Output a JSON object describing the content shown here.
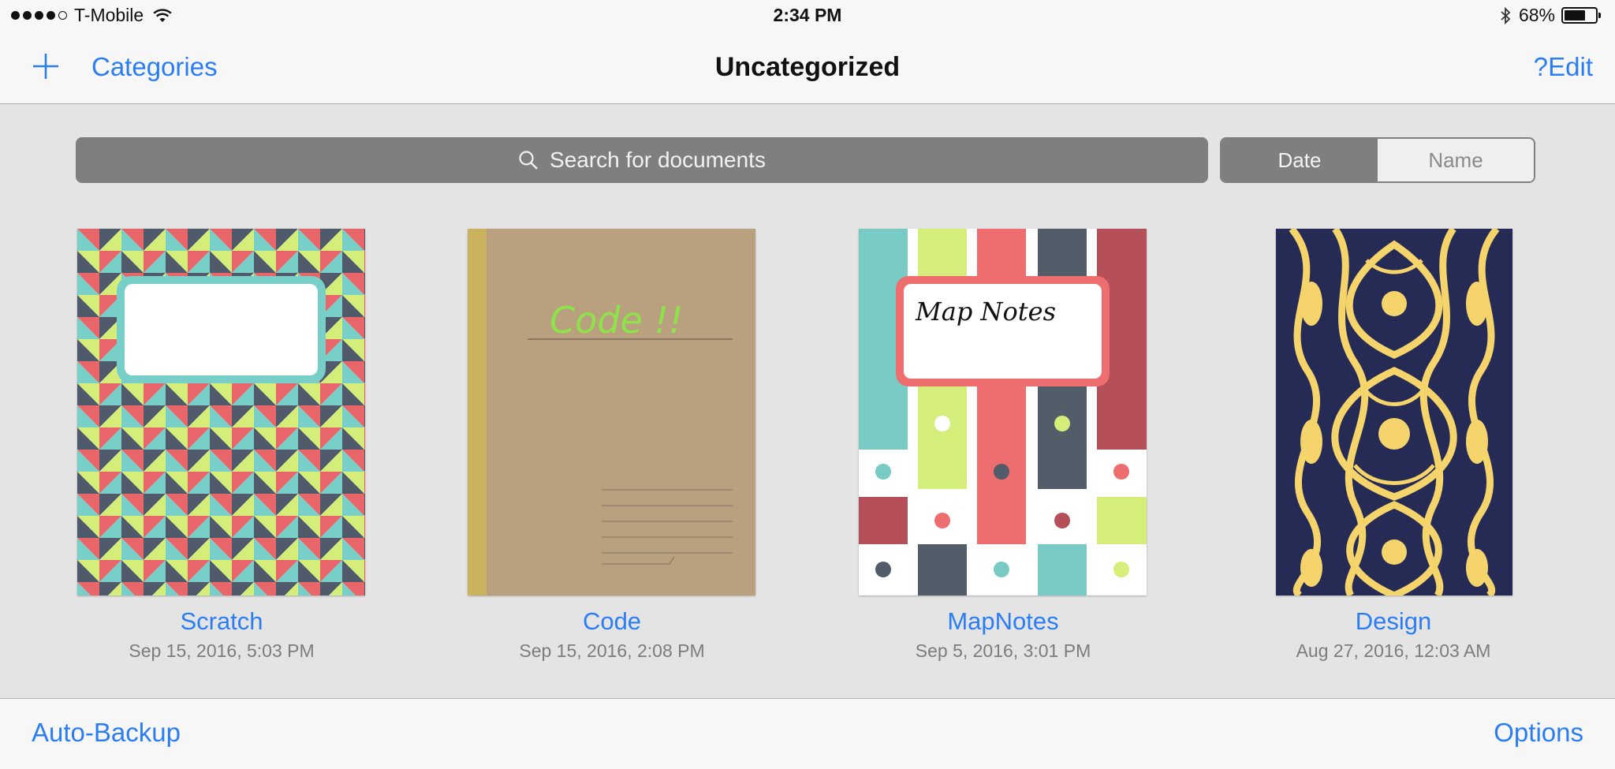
{
  "status_bar": {
    "carrier": "T-Mobile",
    "time": "2:34 PM",
    "battery_percent": "68%",
    "battery_level": 0.68,
    "signal_icon": "signal-dots-icon",
    "wifi_icon": "wifi-icon",
    "bluetooth_icon": "bluetooth-icon"
  },
  "nav": {
    "add_icon": "plus-icon",
    "categories_label": "Categories",
    "title": "Uncategorized",
    "help_label": "?",
    "edit_label": "Edit"
  },
  "search": {
    "placeholder": "Search for documents",
    "icon": "search-icon"
  },
  "sort": {
    "options": [
      "Date",
      "Name"
    ],
    "selected": "Date"
  },
  "documents": [
    {
      "name": "Scratch",
      "date": "Sep 15, 2016, 5:03 PM",
      "cover": "geometric-triangles"
    },
    {
      "name": "Code",
      "date": "Sep 15, 2016, 2:08 PM",
      "cover": "kraft-paper",
      "cover_text": "Code !!"
    },
    {
      "name": "MapNotes",
      "date": "Sep 5, 2016, 3:01 PM",
      "cover": "stripes-dots",
      "cover_text": "Map Notes"
    },
    {
      "name": "Design",
      "date": "Aug 27, 2016, 12:03 AM",
      "cover": "art-nouveau-yellow-navy"
    }
  ],
  "colors": {
    "accent": "#2b7df4",
    "search_bg": "#7f7f7f",
    "background": "#e4e4e4"
  },
  "toolbar": {
    "left_label": "Auto-Backup",
    "right_label": "Options"
  }
}
